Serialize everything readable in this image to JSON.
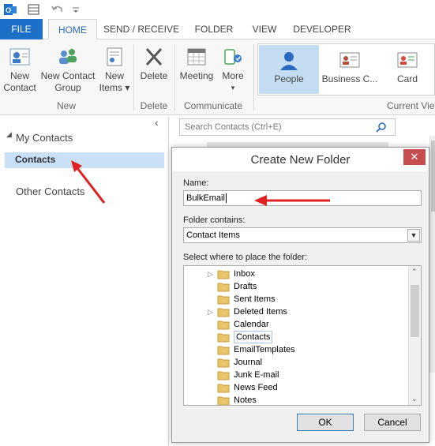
{
  "tabs": {
    "file": "FILE",
    "home": "HOME",
    "send_receive": "SEND / RECEIVE",
    "folder": "FOLDER",
    "view": "VIEW",
    "developer": "DEVELOPER"
  },
  "ribbon": {
    "new_contact": [
      "New",
      "Contact"
    ],
    "new_contact_group": [
      "New Contact",
      "Group"
    ],
    "new_items": [
      "New",
      "Items ▾"
    ],
    "delete": "Delete",
    "meeting": "Meeting",
    "more": [
      "More",
      "▾"
    ],
    "people": "People",
    "business_card": "Business C...",
    "card": "Card",
    "groups": {
      "new": "New",
      "delete": "Delete",
      "communicate": "Communicate",
      "current_view": "Current View"
    }
  },
  "nav": {
    "collapse_glyph": "‹",
    "my_contacts": "My Contacts",
    "contacts": "Contacts",
    "other_contacts": "Other Contacts"
  },
  "search": {
    "placeholder": "Search Contacts (Ctrl+E)"
  },
  "dialog": {
    "title": "Create New Folder",
    "close": "✕",
    "name_label": "Name:",
    "name_value": "BulkEmail",
    "contains_label": "Folder contains:",
    "contains_value": "Contact Items",
    "place_label": "Select where to place the folder:",
    "folders": [
      {
        "label": "Inbox",
        "expandable": true
      },
      {
        "label": "Drafts",
        "expandable": false
      },
      {
        "label": "Sent Items",
        "expandable": false
      },
      {
        "label": "Deleted Items",
        "expandable": true
      },
      {
        "label": "Calendar",
        "expandable": false
      },
      {
        "label": "Contacts",
        "expandable": false
      },
      {
        "label": "EmailTemplates",
        "expandable": false
      },
      {
        "label": "Journal",
        "expandable": false
      },
      {
        "label": "Junk E-mail",
        "expandable": false
      },
      {
        "label": "News Feed",
        "expandable": false
      },
      {
        "label": "Notes",
        "expandable": false
      }
    ],
    "ok": "OK",
    "cancel": "Cancel"
  },
  "colors": {
    "file_tab": "#1e6fc8",
    "accent_blue": "#2a6bbf",
    "selected_nav": "#c9e0f7",
    "people_selected": "#c5ddf3",
    "annotation_arrow": "#e02020",
    "close_button": "#c74e4e"
  }
}
